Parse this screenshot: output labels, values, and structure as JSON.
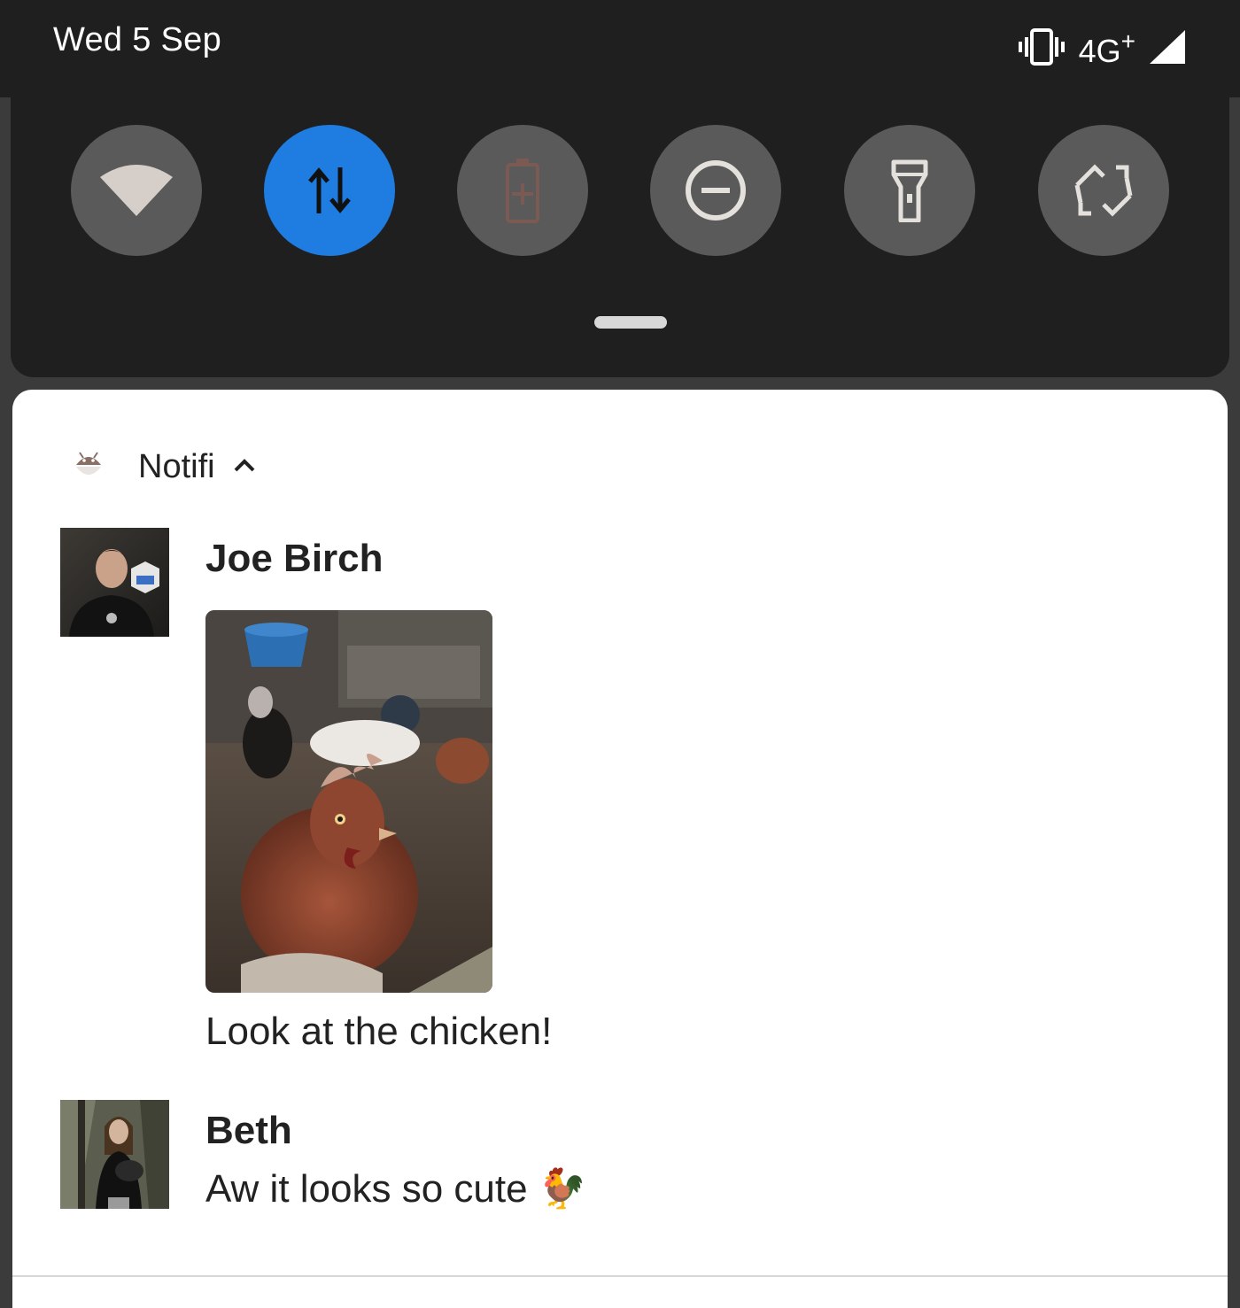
{
  "status_bar": {
    "date": "Wed 5 Sep",
    "network": "4G",
    "network_suffix": "+"
  },
  "quick_settings": {
    "tiles": [
      {
        "name": "wifi",
        "active": false
      },
      {
        "name": "mobile-data",
        "active": true
      },
      {
        "name": "battery-saver",
        "active": false
      },
      {
        "name": "do-not-disturb",
        "active": false
      },
      {
        "name": "flashlight",
        "active": false
      },
      {
        "name": "auto-rotate",
        "active": false
      }
    ],
    "active_color": "#1f7ce0",
    "inactive_color": "#5a5a5a"
  },
  "notification": {
    "app_name": "Notifi",
    "messages": [
      {
        "sender": "Joe Birch",
        "has_image": true,
        "text": "Look at the chicken!"
      },
      {
        "sender": "Beth",
        "text": "Aw it looks so cute 🐓"
      }
    ]
  }
}
